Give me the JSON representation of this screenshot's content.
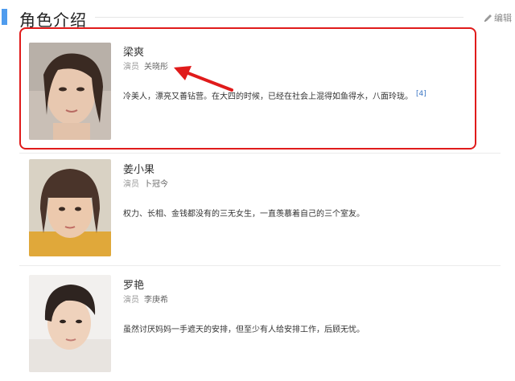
{
  "section": {
    "title": "角色介绍",
    "edit_label": "编辑"
  },
  "characters": [
    {
      "name": "梁爽",
      "role_label": "演员",
      "actor": "关晓彤",
      "description": "冷美人，漂亮又善钻营。在大四的时候，已经在社会上混得如鱼得水，八面玲珑。",
      "citation": "[4]"
    },
    {
      "name": "姜小果",
      "role_label": "演员",
      "actor": "卜冠今",
      "description": "权力、长相、金钱都没有的三无女生，一直羡慕着自己的三个室友。"
    },
    {
      "name": "罗艳",
      "role_label": "演员",
      "actor": "李庚希",
      "description": "虽然讨厌妈妈一手遮天的安排，但至少有人给安排工作，后顾无忧。"
    }
  ],
  "annotation": {
    "box_color": "#e01b1b",
    "arrow_color": "#e01b1b"
  },
  "colors": {
    "accent": "#4f9cee",
    "citation": "#3b76c4"
  }
}
